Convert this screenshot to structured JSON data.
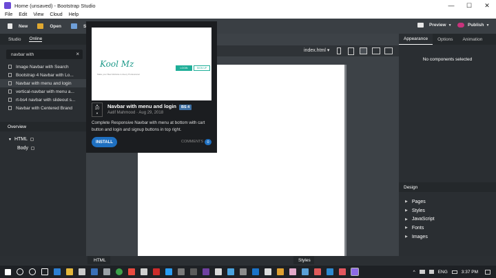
{
  "window": {
    "title": "Home (unsaved) - Bootstrap Studio",
    "minimize": "—",
    "maximize": "☐",
    "close": "✕"
  },
  "menu": [
    "File",
    "Edit",
    "View",
    "Cloud",
    "Help"
  ],
  "toolbar": {
    "new_label": "New",
    "open_label": "Open",
    "save_label": "Save",
    "preview_label": "Preview",
    "publish_label": "Publish"
  },
  "left_panel": {
    "tabs": [
      "Studio",
      "Online"
    ],
    "active_tab": "Online",
    "search_value": "navbar with",
    "results": [
      "Image Navbar with Search",
      "Bootstrap 4 Navbar with Lo...",
      "Navbar with menu and login",
      "vertical-navbar with menu a...",
      "rt-bs4 navbar with slideout s...",
      "Navbar with Centered Brand"
    ],
    "selected_index": 2,
    "overview_label": "Overview",
    "tree": {
      "html": "HTML",
      "body": "Body"
    }
  },
  "center": {
    "page_file": "index.html ▾",
    "html_tab": "HTML",
    "styles_tab": "Styles"
  },
  "popup": {
    "preview": {
      "logo": "Kool Mz",
      "tagline": "Make your Best Website to Every Professional",
      "login_btn": "LOGIN",
      "signup_btn": "SIGN UP"
    },
    "votes": "10",
    "title": "Navbar with menu and login",
    "badge": "BS 4",
    "author": "Aatif Mahmood · Aug 29, 2018",
    "description": "Complete Responsive Navbar with menu at bottom with cart button and login and signup buttons in top right.",
    "install_label": "INSTALL",
    "comments_label": "COMMENTS",
    "comments_count": "0"
  },
  "right_panel": {
    "tabs": [
      "Appearance",
      "Options",
      "Animation"
    ],
    "active_tab": "Appearance",
    "empty_message": "No components selected",
    "design_label": "Design",
    "design_items": [
      "Pages",
      "Styles",
      "JavaScript",
      "Fonts",
      "Images"
    ]
  },
  "taskbar": {
    "lang": "ENG",
    "time": "3:37 PM"
  },
  "colors": {
    "accent": "#1f70c1",
    "badge": "#3d6fa3",
    "panel": "#2a2e32",
    "publish": "#c8337c"
  }
}
